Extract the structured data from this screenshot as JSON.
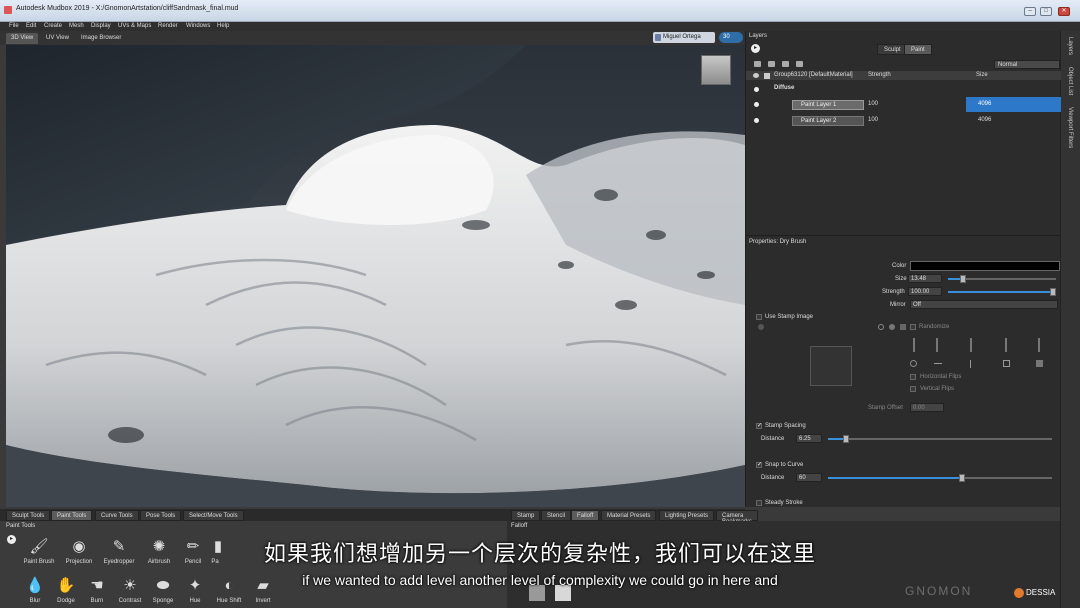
{
  "window": {
    "title": "Autodesk Mudbox 2019 - X:/GnomonArtstation/cliffSandmask_final.mud",
    "controls": {
      "minimize": "–",
      "maximize": "□",
      "close": "✕"
    }
  },
  "menubar": [
    "File",
    "Edit",
    "Create",
    "Mesh",
    "Display",
    "UVs & Maps",
    "Render",
    "Windows",
    "Help"
  ],
  "view_tabs": [
    {
      "label": "3D View",
      "active": true
    },
    {
      "label": "UV View",
      "active": false
    },
    {
      "label": "Image Browser",
      "active": false
    }
  ],
  "account": {
    "user": "Miguel Ortega",
    "badge": "30"
  },
  "right_strip": [
    "Layers",
    "Object List",
    "Viewport Filters"
  ],
  "layers_panel": {
    "title": "Layers",
    "tabs": [
      {
        "label": "Sculpt",
        "active": false
      },
      {
        "label": "Paint",
        "active": true
      }
    ],
    "blend_mode": "Normal",
    "columns": {
      "name": "Group63120 [DefaultMaterial]",
      "strength": "Strength",
      "size": "Size"
    },
    "channel": "Diffuse",
    "layers": [
      {
        "name": "Paint Layer 1",
        "strength": "100",
        "size": "4096",
        "selected": true
      },
      {
        "name": "Paint Layer 2",
        "strength": "100",
        "size": "4096",
        "selected": false
      }
    ]
  },
  "properties": {
    "title": "Properties: Dry Brush",
    "color_label": "Color",
    "color_value": "#000000",
    "size_label": "Size",
    "size_value": "13.48",
    "size_level": 0.14,
    "strength_label": "Strength",
    "strength_value": "100.00",
    "strength_level": 1.0,
    "mirror_label": "Mirror",
    "mirror_value": "Off",
    "use_stamp_image": "Use Stamp Image",
    "randomize": "Randomize",
    "horizontal_flips": "Horizontal Flips",
    "vertical_flips": "Vertical Flips",
    "stamp_offset_label": "Stamp Offset",
    "stamp_offset_value": "0.00",
    "stamp_spacing": "Stamp Spacing",
    "stamp_spacing_distance_label": "Distance",
    "stamp_spacing_distance_value": "6.25",
    "stamp_spacing_level": 0.08,
    "snap_to_curve": "Snap to Curve",
    "snap_distance_label": "Distance",
    "snap_distance_value": "60",
    "snap_distance_level": 0.6,
    "steady_stroke": "Steady Stroke",
    "check_mark": "✓"
  },
  "bottom_tabs_left": [
    {
      "label": "Sculpt Tools",
      "active": false
    },
    {
      "label": "Paint Tools",
      "active": true
    },
    {
      "label": "Curve Tools",
      "active": false
    },
    {
      "label": "Pose Tools",
      "active": false
    },
    {
      "label": "Select/Move Tools",
      "active": false
    }
  ],
  "bottom_tabs_right": [
    {
      "label": "Stamp",
      "active": false
    },
    {
      "label": "Stencil",
      "active": false
    },
    {
      "label": "Falloff",
      "active": true
    },
    {
      "label": "Material Presets",
      "active": false
    },
    {
      "label": "Lighting Presets",
      "active": false
    },
    {
      "label": "Camera Bookmarks",
      "active": false
    }
  ],
  "paint_tools": {
    "title": "Paint Tools",
    "row1": [
      {
        "label": "Paint Brush",
        "icon": "brush-icon",
        "glyph": "🖌"
      },
      {
        "label": "Projection",
        "icon": "projection-icon",
        "glyph": "◉"
      },
      {
        "label": "Eyedropper",
        "icon": "eyedropper-icon",
        "glyph": "✎"
      },
      {
        "label": "Airbrush",
        "icon": "airbrush-icon",
        "glyph": "✺"
      },
      {
        "label": "Pencil",
        "icon": "pencil-icon",
        "glyph": "✏"
      },
      {
        "label": "Pa",
        "icon": "paint-tool-icon",
        "glyph": "▮"
      }
    ],
    "row2": [
      {
        "label": "Blur",
        "icon": "blur-icon",
        "glyph": "💧"
      },
      {
        "label": "Dodge",
        "icon": "dodge-icon",
        "glyph": "✋"
      },
      {
        "label": "Burn",
        "icon": "burn-icon",
        "glyph": "☚"
      },
      {
        "label": "Contrast",
        "icon": "contrast-icon",
        "glyph": "☀"
      },
      {
        "label": "Sponge",
        "icon": "sponge-icon",
        "glyph": "⬬"
      },
      {
        "label": "Hue",
        "icon": "hue-icon",
        "glyph": "✦"
      },
      {
        "label": "Hue Shift",
        "icon": "hue-shift-icon",
        "glyph": "◐"
      },
      {
        "label": "Invert",
        "icon": "invert-icon",
        "glyph": "▰"
      }
    ]
  },
  "falloff_panel": {
    "title": "Falloff"
  },
  "subtitles": {
    "cn": "如果我们想增加另一个层次的复杂性，我们可以在这里",
    "en": "if we wanted to add level another level of complexity we could go in here and"
  },
  "watermark": {
    "gnomon": "GNOMON",
    "brand": "DESSIA"
  }
}
